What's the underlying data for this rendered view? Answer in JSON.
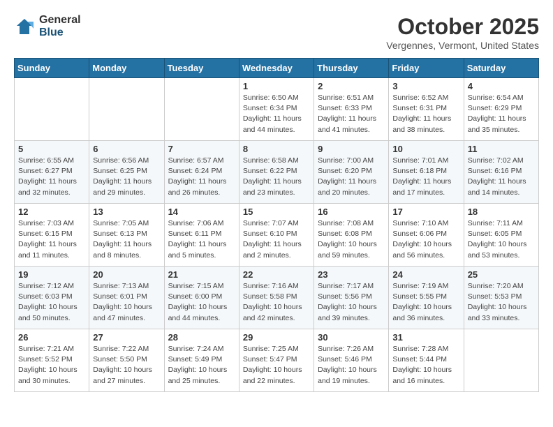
{
  "header": {
    "logo_general": "General",
    "logo_blue": "Blue",
    "month": "October 2025",
    "location": "Vergennes, Vermont, United States"
  },
  "weekdays": [
    "Sunday",
    "Monday",
    "Tuesday",
    "Wednesday",
    "Thursday",
    "Friday",
    "Saturday"
  ],
  "weeks": [
    [
      {
        "day": "",
        "info": ""
      },
      {
        "day": "",
        "info": ""
      },
      {
        "day": "",
        "info": ""
      },
      {
        "day": "1",
        "info": "Sunrise: 6:50 AM\nSunset: 6:34 PM\nDaylight: 11 hours\nand 44 minutes."
      },
      {
        "day": "2",
        "info": "Sunrise: 6:51 AM\nSunset: 6:33 PM\nDaylight: 11 hours\nand 41 minutes."
      },
      {
        "day": "3",
        "info": "Sunrise: 6:52 AM\nSunset: 6:31 PM\nDaylight: 11 hours\nand 38 minutes."
      },
      {
        "day": "4",
        "info": "Sunrise: 6:54 AM\nSunset: 6:29 PM\nDaylight: 11 hours\nand 35 minutes."
      }
    ],
    [
      {
        "day": "5",
        "info": "Sunrise: 6:55 AM\nSunset: 6:27 PM\nDaylight: 11 hours\nand 32 minutes."
      },
      {
        "day": "6",
        "info": "Sunrise: 6:56 AM\nSunset: 6:25 PM\nDaylight: 11 hours\nand 29 minutes."
      },
      {
        "day": "7",
        "info": "Sunrise: 6:57 AM\nSunset: 6:24 PM\nDaylight: 11 hours\nand 26 minutes."
      },
      {
        "day": "8",
        "info": "Sunrise: 6:58 AM\nSunset: 6:22 PM\nDaylight: 11 hours\nand 23 minutes."
      },
      {
        "day": "9",
        "info": "Sunrise: 7:00 AM\nSunset: 6:20 PM\nDaylight: 11 hours\nand 20 minutes."
      },
      {
        "day": "10",
        "info": "Sunrise: 7:01 AM\nSunset: 6:18 PM\nDaylight: 11 hours\nand 17 minutes."
      },
      {
        "day": "11",
        "info": "Sunrise: 7:02 AM\nSunset: 6:16 PM\nDaylight: 11 hours\nand 14 minutes."
      }
    ],
    [
      {
        "day": "12",
        "info": "Sunrise: 7:03 AM\nSunset: 6:15 PM\nDaylight: 11 hours\nand 11 minutes."
      },
      {
        "day": "13",
        "info": "Sunrise: 7:05 AM\nSunset: 6:13 PM\nDaylight: 11 hours\nand 8 minutes."
      },
      {
        "day": "14",
        "info": "Sunrise: 7:06 AM\nSunset: 6:11 PM\nDaylight: 11 hours\nand 5 minutes."
      },
      {
        "day": "15",
        "info": "Sunrise: 7:07 AM\nSunset: 6:10 PM\nDaylight: 11 hours\nand 2 minutes."
      },
      {
        "day": "16",
        "info": "Sunrise: 7:08 AM\nSunset: 6:08 PM\nDaylight: 10 hours\nand 59 minutes."
      },
      {
        "day": "17",
        "info": "Sunrise: 7:10 AM\nSunset: 6:06 PM\nDaylight: 10 hours\nand 56 minutes."
      },
      {
        "day": "18",
        "info": "Sunrise: 7:11 AM\nSunset: 6:05 PM\nDaylight: 10 hours\nand 53 minutes."
      }
    ],
    [
      {
        "day": "19",
        "info": "Sunrise: 7:12 AM\nSunset: 6:03 PM\nDaylight: 10 hours\nand 50 minutes."
      },
      {
        "day": "20",
        "info": "Sunrise: 7:13 AM\nSunset: 6:01 PM\nDaylight: 10 hours\nand 47 minutes."
      },
      {
        "day": "21",
        "info": "Sunrise: 7:15 AM\nSunset: 6:00 PM\nDaylight: 10 hours\nand 44 minutes."
      },
      {
        "day": "22",
        "info": "Sunrise: 7:16 AM\nSunset: 5:58 PM\nDaylight: 10 hours\nand 42 minutes."
      },
      {
        "day": "23",
        "info": "Sunrise: 7:17 AM\nSunset: 5:56 PM\nDaylight: 10 hours\nand 39 minutes."
      },
      {
        "day": "24",
        "info": "Sunrise: 7:19 AM\nSunset: 5:55 PM\nDaylight: 10 hours\nand 36 minutes."
      },
      {
        "day": "25",
        "info": "Sunrise: 7:20 AM\nSunset: 5:53 PM\nDaylight: 10 hours\nand 33 minutes."
      }
    ],
    [
      {
        "day": "26",
        "info": "Sunrise: 7:21 AM\nSunset: 5:52 PM\nDaylight: 10 hours\nand 30 minutes."
      },
      {
        "day": "27",
        "info": "Sunrise: 7:22 AM\nSunset: 5:50 PM\nDaylight: 10 hours\nand 27 minutes."
      },
      {
        "day": "28",
        "info": "Sunrise: 7:24 AM\nSunset: 5:49 PM\nDaylight: 10 hours\nand 25 minutes."
      },
      {
        "day": "29",
        "info": "Sunrise: 7:25 AM\nSunset: 5:47 PM\nDaylight: 10 hours\nand 22 minutes."
      },
      {
        "day": "30",
        "info": "Sunrise: 7:26 AM\nSunset: 5:46 PM\nDaylight: 10 hours\nand 19 minutes."
      },
      {
        "day": "31",
        "info": "Sunrise: 7:28 AM\nSunset: 5:44 PM\nDaylight: 10 hours\nand 16 minutes."
      },
      {
        "day": "",
        "info": ""
      }
    ]
  ]
}
